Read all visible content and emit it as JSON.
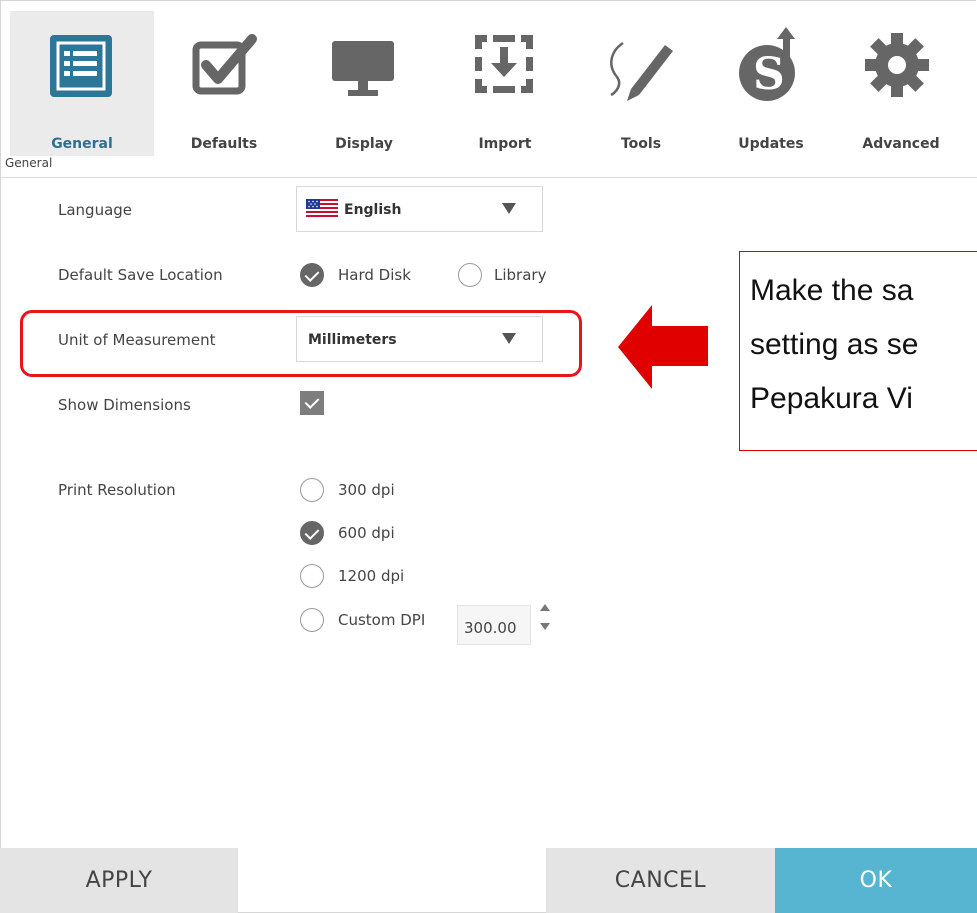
{
  "toolbar": {
    "tabs": [
      {
        "label": "General",
        "icon": "general-list-icon",
        "active": true
      },
      {
        "label": "Defaults",
        "icon": "checkbox-icon",
        "active": false
      },
      {
        "label": "Display",
        "icon": "monitor-icon",
        "active": false
      },
      {
        "label": "Import",
        "icon": "import-icon",
        "active": false
      },
      {
        "label": "Tools",
        "icon": "pen-icon",
        "active": false
      },
      {
        "label": "Updates",
        "icon": "updates-icon",
        "active": false
      },
      {
        "label": "Advanced",
        "icon": "gear-icon",
        "active": false
      }
    ]
  },
  "section": {
    "caption": "General"
  },
  "settings": {
    "language": {
      "label": "Language",
      "value": "English",
      "flag": "us-flag-icon"
    },
    "save_location": {
      "label": "Default Save Location",
      "options": [
        "Hard Disk",
        "Library"
      ],
      "selected": "Hard Disk"
    },
    "unit": {
      "label": "Unit of Measurement",
      "value": "Millimeters"
    },
    "dimensions": {
      "label": "Show Dimensions",
      "checked": true
    },
    "print_resolution": {
      "label": "Print Resolution",
      "options": [
        "300 dpi",
        "600 dpi",
        "1200 dpi",
        "Custom DPI"
      ],
      "selected": "600 dpi",
      "custom_value": "300.00"
    }
  },
  "annotation": {
    "lines": [
      "Make the sa",
      "setting as se",
      "Pepakura Vi"
    ],
    "color": "#e00000"
  },
  "buttons": {
    "apply": "APPLY",
    "cancel": "CANCEL",
    "ok": "OK"
  },
  "colors": {
    "accent": "#2c6f8f",
    "ok_button": "#57b5d1"
  }
}
